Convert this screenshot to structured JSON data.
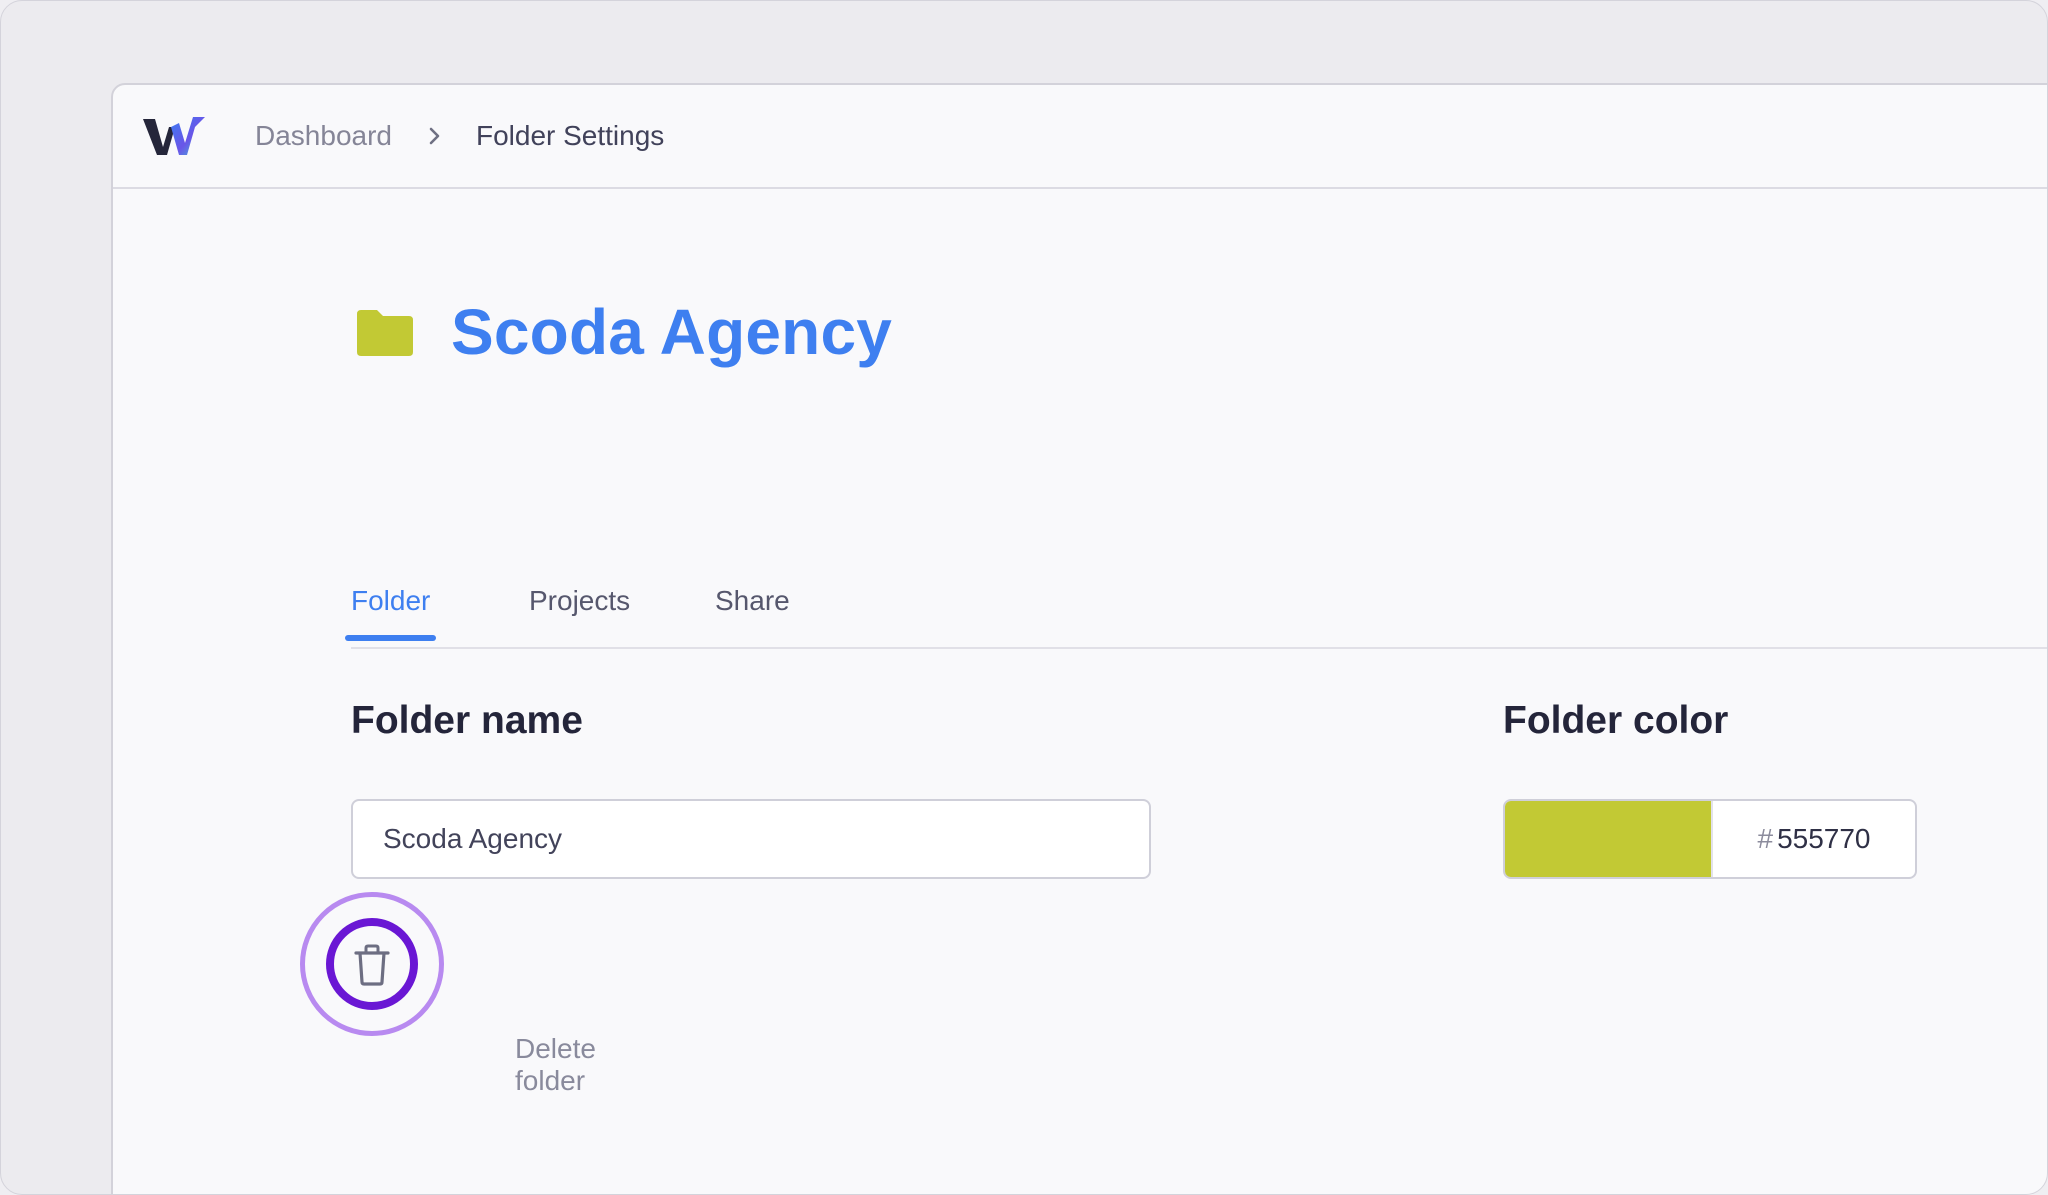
{
  "breadcrumb": {
    "dashboard_label": "Dashboard",
    "current_label": "Folder Settings"
  },
  "folder": {
    "title": "Scoda Agency",
    "icon": "folder-icon",
    "color": "#c2c934"
  },
  "tabs": [
    {
      "label": "Folder",
      "active": true
    },
    {
      "label": "Projects",
      "active": false
    },
    {
      "label": "Share",
      "active": false
    }
  ],
  "form": {
    "name_label": "Folder name",
    "name_value": "Scoda Agency",
    "color_label": "Folder color",
    "color_hash": "#",
    "color_hex": "555770"
  },
  "actions": {
    "delete_label": "Delete folder",
    "delete_icon": "trash-icon"
  },
  "theme": {
    "accent": "#3e7ff0",
    "highlight_ring": "#6a17d4",
    "highlight_halo": "#b88af0"
  }
}
